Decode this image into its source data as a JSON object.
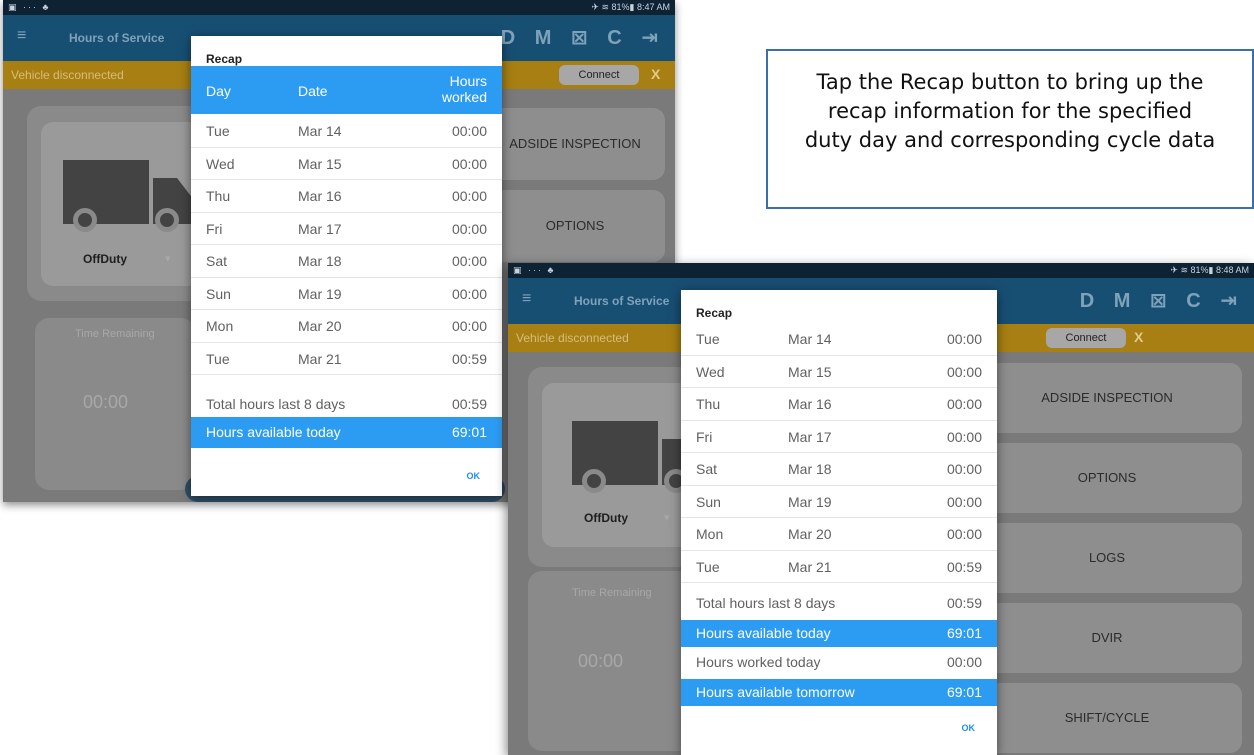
{
  "callout": {
    "line1": "Tap the Recap button to bring up the",
    "line2": "recap information for the specified",
    "line3": "duty day and corresponding cycle data"
  },
  "screen1": {
    "status": {
      "left": "▣ ··· ♣",
      "right": "✈ ≋ 81%▮ 8:47 AM"
    },
    "appbar": {
      "menu": "≡",
      "title": "Hours of Service",
      "actions": "D M ⊠ C ⇥"
    },
    "banner": {
      "text": "Vehicle disconnected",
      "connect": "Connect",
      "close": "X"
    },
    "duty_status": "OffDuty",
    "time_remaining_label": "Time Remaining",
    "time_value": "00:00",
    "buttons": {
      "roadside": "ADSIDE INSPECTION",
      "options": "OPTIONS"
    },
    "dialog": {
      "title": "Recap",
      "header": {
        "day": "Day",
        "date": "Date",
        "hours1": "Hours",
        "hours2": "worked"
      },
      "rows": [
        {
          "day": "Tue",
          "date": "Mar 14",
          "hours": "00:00"
        },
        {
          "day": "Wed",
          "date": "Mar 15",
          "hours": "00:00"
        },
        {
          "day": "Thu",
          "date": "Mar 16",
          "hours": "00:00"
        },
        {
          "day": "Fri",
          "date": "Mar 17",
          "hours": "00:00"
        },
        {
          "day": "Sat",
          "date": "Mar 18",
          "hours": "00:00"
        },
        {
          "day": "Sun",
          "date": "Mar 19",
          "hours": "00:00"
        },
        {
          "day": "Mon",
          "date": "Mar 20",
          "hours": "00:00"
        },
        {
          "day": "Tue",
          "date": "Mar 21",
          "hours": "00:59"
        }
      ],
      "total_label": "Total hours last 8 days",
      "total_value": "00:59",
      "available_label": "Hours available today",
      "available_value": "69:01",
      "ok": "OK"
    }
  },
  "screen2": {
    "status": {
      "left": "▣ ··· ♣",
      "right": "✈ ≋ 81%▮ 8:48 AM"
    },
    "appbar": {
      "menu": "≡",
      "title": "Hours of Service",
      "actions": "D M ⊠ C ⇥"
    },
    "banner": {
      "text": "Vehicle disconnected",
      "connect": "Connect",
      "close": "X"
    },
    "duty_status": "OffDuty",
    "time_remaining_label": "Time Remaining",
    "time_value": "00:00",
    "buttons": {
      "roadside": "ADSIDE INSPECTION",
      "options": "OPTIONS",
      "logs": "LOGS",
      "dvir": "DVIR",
      "shift": "SHIFT/CYCLE"
    },
    "dialog": {
      "title": "Recap",
      "rows": [
        {
          "day": "Tue",
          "date": "Mar 14",
          "hours": "00:00"
        },
        {
          "day": "Wed",
          "date": "Mar 15",
          "hours": "00:00"
        },
        {
          "day": "Thu",
          "date": "Mar 16",
          "hours": "00:00"
        },
        {
          "day": "Fri",
          "date": "Mar 17",
          "hours": "00:00"
        },
        {
          "day": "Sat",
          "date": "Mar 18",
          "hours": "00:00"
        },
        {
          "day": "Sun",
          "date": "Mar 19",
          "hours": "00:00"
        },
        {
          "day": "Mon",
          "date": "Mar 20",
          "hours": "00:00"
        },
        {
          "day": "Tue",
          "date": "Mar 21",
          "hours": "00:59"
        }
      ],
      "total_label": "Total hours last 8 days",
      "total_value": "00:59",
      "available_label": "Hours available today",
      "available_value": "69:01",
      "worked_today_label": "Hours worked today",
      "worked_today_value": "00:00",
      "tomorrow_label": "Hours available tomorrow",
      "tomorrow_value": "69:01",
      "ok": "OK"
    }
  },
  "colors": {
    "accent": "#2c9cf2",
    "appbar": "#174f73",
    "banner": "#a77f12",
    "callout_border": "#3b6fa7"
  }
}
